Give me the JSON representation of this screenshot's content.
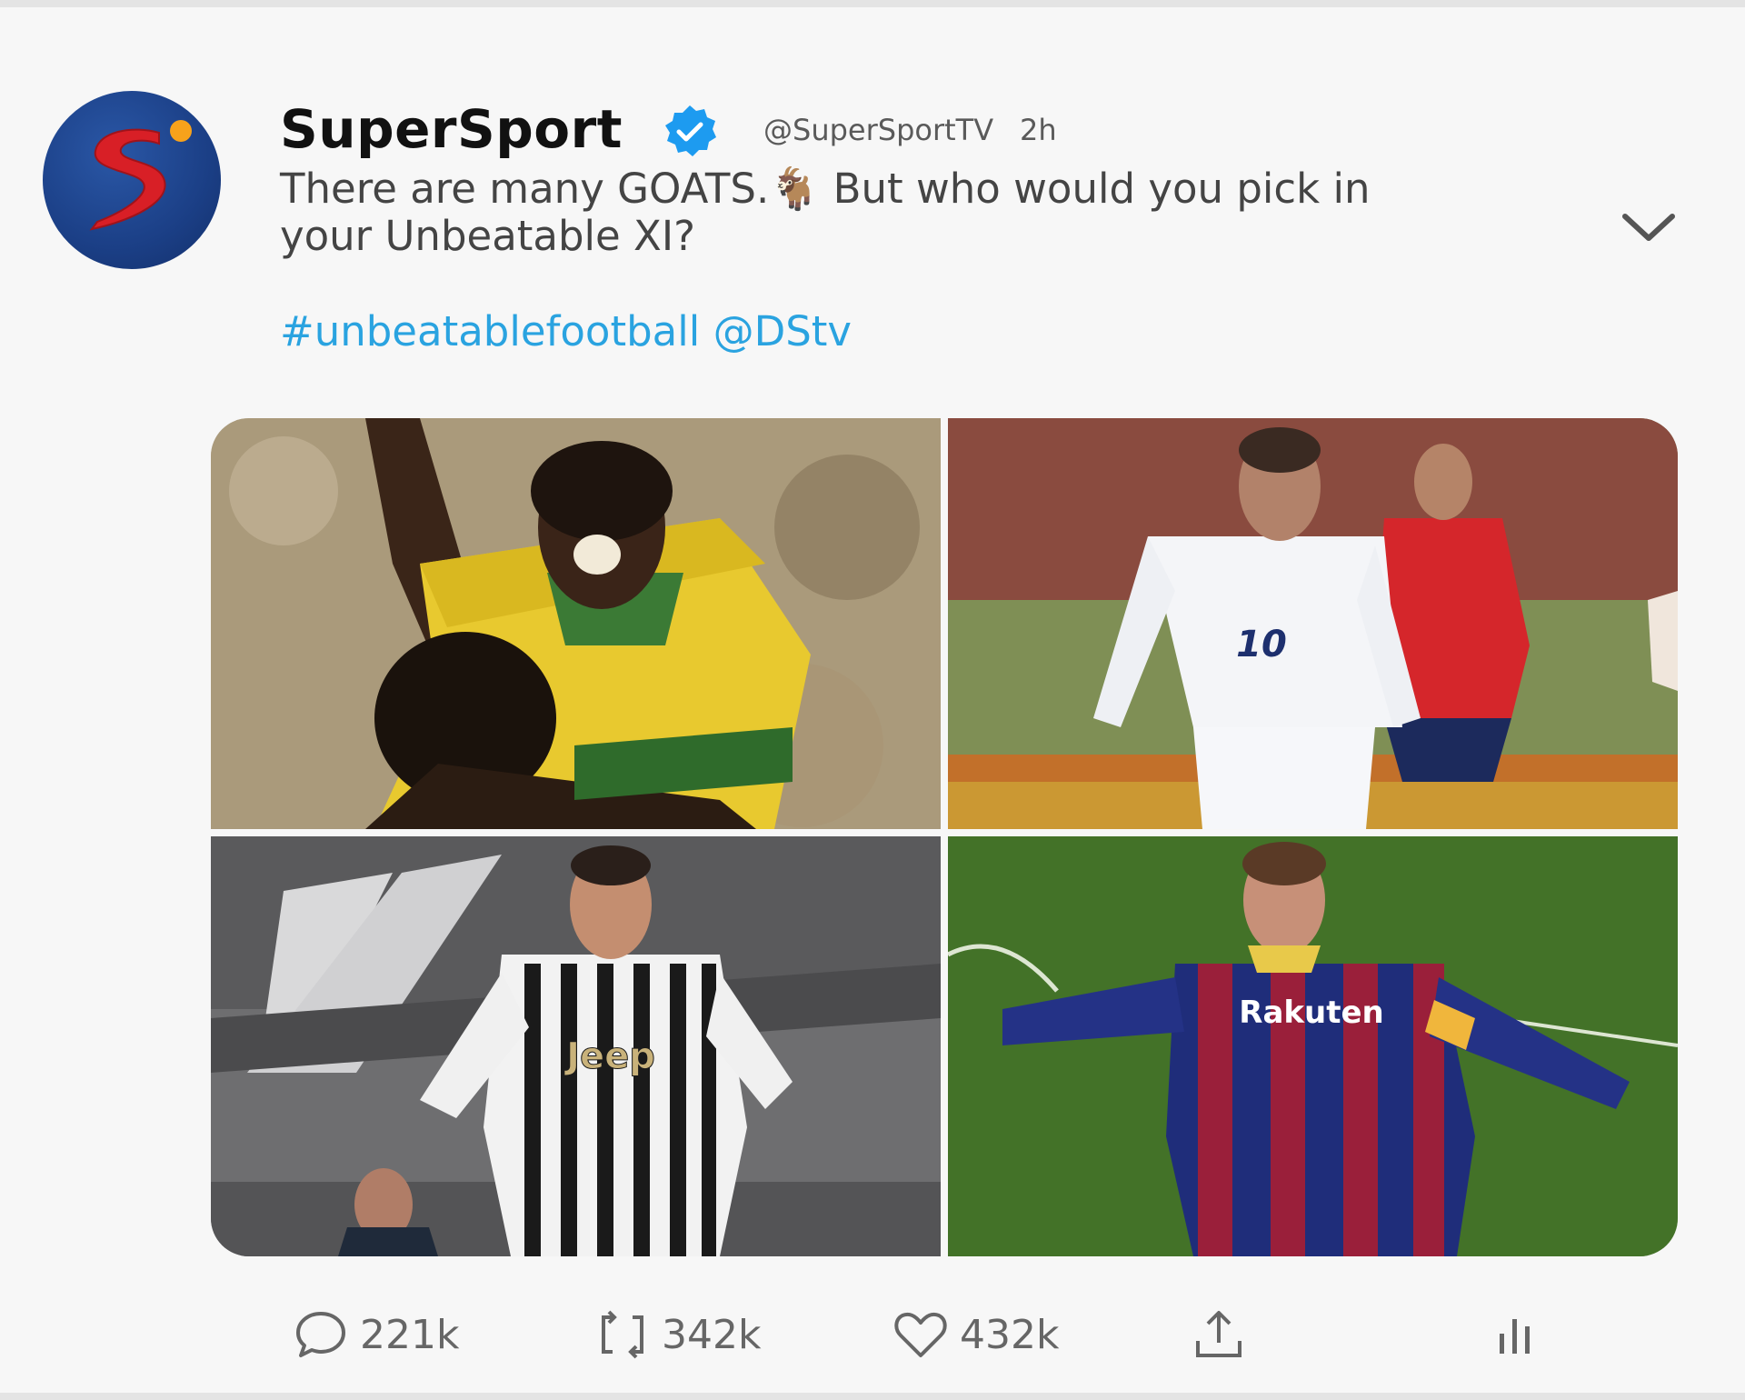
{
  "tweet": {
    "author_name": "SuperSport",
    "handle": "@SuperSportTV",
    "time": "2h",
    "text": "There are many GOATS.🐐 But who would you pick in your Unbeatable XI?",
    "hashtag": "#unbeatablefootball",
    "mention": "@DStv",
    "avatar_icon": "supersport-logo",
    "verified_icon": "verified-badge-icon",
    "menu_icon": "chevron-down-icon"
  },
  "media": [
    {
      "icon": "photo-player-yellow-jersey"
    },
    {
      "icon": "photo-player-white-jersey-10"
    },
    {
      "icon": "photo-player-striped-jersey-jeep"
    },
    {
      "icon": "photo-player-blaugrana-jersey-rakuten"
    }
  ],
  "media_text": {
    "jersey_number": "10",
    "sponsor_1": "Jeep",
    "sponsor_2": "Rakuten"
  },
  "actions": {
    "reply_count": "221k",
    "retweet_count": "342k",
    "like_count": "432k",
    "reply_icon": "comment-icon",
    "retweet_icon": "retweet-icon",
    "like_icon": "heart-icon",
    "share_icon": "share-icon",
    "stats_icon": "analytics-icon"
  },
  "colors": {
    "link": "#2aa3e0",
    "verified": "#1d9bf0",
    "text": "#444444",
    "name": "#111111",
    "muted": "#5a5a5a"
  }
}
